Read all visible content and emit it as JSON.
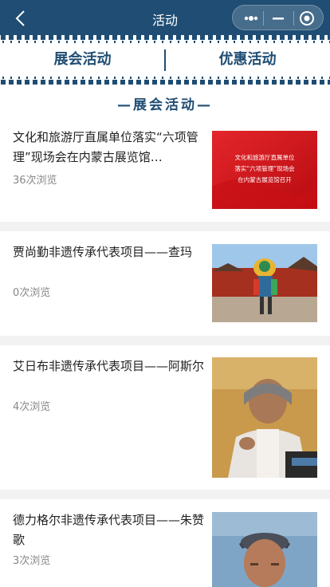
{
  "app": {
    "title": "活动"
  },
  "tabs": [
    {
      "label": "展会活动"
    },
    {
      "label": "优惠活动"
    }
  ],
  "section": {
    "heading": "—展会活动—"
  },
  "articles": [
    {
      "title": "文化和旅游厅直属单位落实“六项管理”现场会在内蒙古展览馆…",
      "views": "36次浏览",
      "image_caption": [
        "文化和旅游厅直属单位",
        "落实“六项管理”现场会",
        "在内蒙古展览馆召开"
      ]
    },
    {
      "title": "贾尚勤非遗传承代表项目——查玛",
      "views": "0次浏览"
    },
    {
      "title": "艾日布非遗传承代表项目——阿斯尔",
      "views": "4次浏览"
    },
    {
      "title": "德力格尔非遗传承代表项目——朱赞歌",
      "views": "3次浏览"
    }
  ],
  "colors": {
    "primary": "#1f4d73",
    "accent_red": "#d8141b"
  },
  "icons": {
    "back": "chevron-left-icon",
    "more": "more-dots-icon",
    "minimize": "minimize-icon",
    "close": "target-close-icon"
  }
}
